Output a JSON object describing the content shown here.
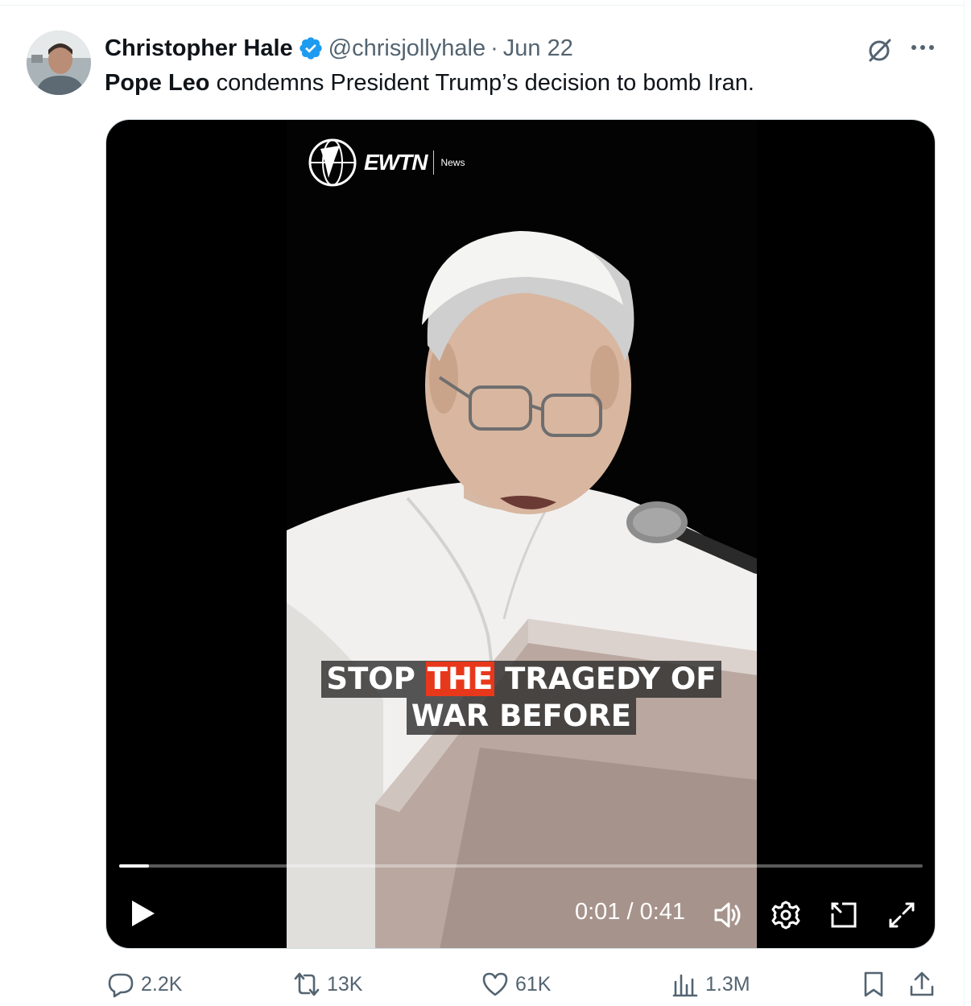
{
  "author": {
    "name": "Christopher Hale",
    "handle": "@chrisjollyhale",
    "separator": "·",
    "date": "Jun 22"
  },
  "tweet": {
    "mention": "Pope Leo",
    "text": " condemns President Trump’s decision to bomb Iran."
  },
  "video": {
    "logo_text": "EWTN",
    "logo_sub": "News",
    "caption": {
      "line1_before": "STOP ",
      "line1_highlight": "THE",
      "line1_after": " TRAGEDY OF",
      "line2": "WAR BEFORE"
    },
    "time": "0:01 / 0:41",
    "progress_fraction": 0.037
  },
  "actions": {
    "replies": "2.2K",
    "reposts": "13K",
    "likes": "61K",
    "views": "1.3M"
  },
  "colors": {
    "verified": "#1d9bf0",
    "secondary_text": "#536471",
    "caption_highlight": "#e8381b"
  },
  "icons": [
    "grok-icon",
    "more-icon",
    "verified-icon",
    "play-icon",
    "volume-icon",
    "settings-icon",
    "pip-icon",
    "fullscreen-icon",
    "reply-icon",
    "repost-icon",
    "like-icon",
    "views-icon",
    "bookmark-icon",
    "share-icon"
  ]
}
